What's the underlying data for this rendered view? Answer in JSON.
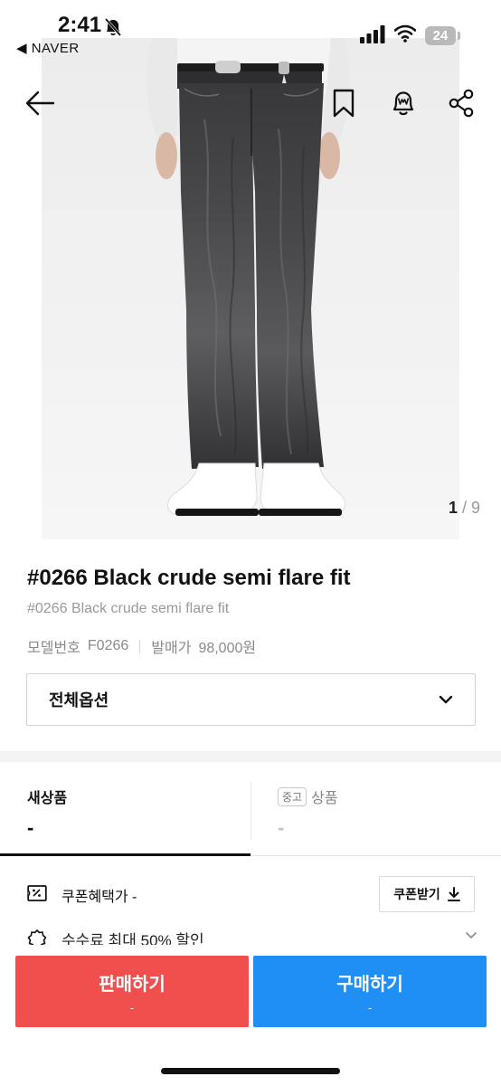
{
  "status_bar": {
    "time": "2:41",
    "back_app": "◀ NAVER",
    "battery": "24",
    "icons": [
      "bell-slash-icon",
      "signal-icon",
      "wifi-icon",
      "battery-icon"
    ]
  },
  "hero": {
    "page_current": "1",
    "page_separator": " / ",
    "page_total": "9",
    "icons": [
      "back-arrow-icon",
      "bookmark-icon",
      "alarm-bell-icon",
      "share-icon"
    ]
  },
  "product": {
    "title": "#0266 Black crude semi flare fit",
    "subtitle": "#0266 Black crude semi flare fit",
    "model_label": "모델번호",
    "model_value": "F0266",
    "release_label": "발매가",
    "release_value": "98,000원"
  },
  "options": {
    "label": "전체옵션"
  },
  "tabs": {
    "new_label": "새상품",
    "new_value": "-",
    "used_chip": "중고",
    "used_label": "상품",
    "used_value": "-"
  },
  "coupon": {
    "label": "쿠폰혜택가 -",
    "button": "쿠폰받기"
  },
  "discount": {
    "text": "수수료 최대 50% 할인"
  },
  "actions": {
    "sell_label": "판매하기",
    "sell_sub": "-",
    "buy_label": "구매하기",
    "buy_sub": "-"
  },
  "colors": {
    "sell": "#f14e4e",
    "buy": "#1f8ff5",
    "denim": "#3b3b3d"
  }
}
